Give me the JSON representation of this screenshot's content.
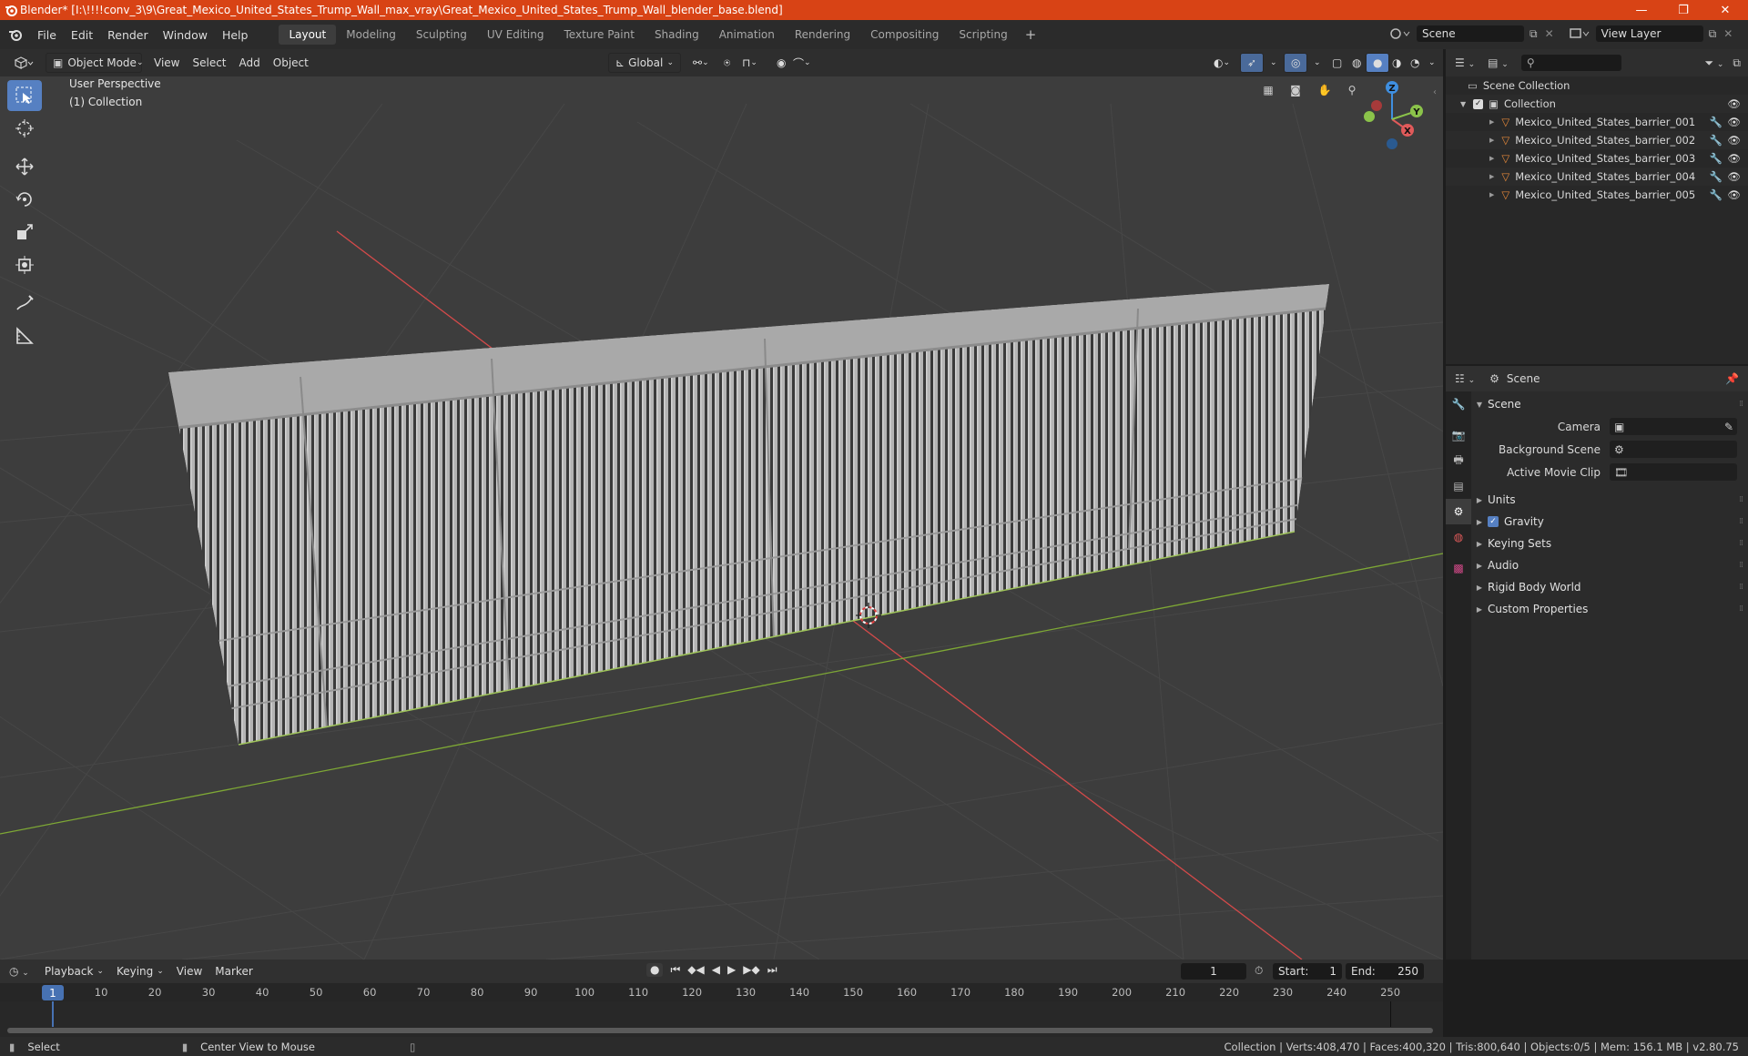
{
  "window": {
    "title": "Blender* [I:\\!!!!conv_3\\9\\Great_Mexico_United_States_Trump_Wall_max_vray\\Great_Mexico_United_States_Trump_Wall_blender_base.blend]",
    "controls": [
      "—",
      "❐",
      "✕"
    ]
  },
  "menu": [
    "File",
    "Edit",
    "Render",
    "Window",
    "Help"
  ],
  "workspaces": [
    "Layout",
    "Modeling",
    "Sculpting",
    "UV Editing",
    "Texture Paint",
    "Shading",
    "Animation",
    "Rendering",
    "Compositing",
    "Scripting"
  ],
  "active_workspace": "Layout",
  "scene_selector": "Scene",
  "view_layer": "View Layer",
  "viewport": {
    "mode": "Object Mode",
    "menus": [
      "View",
      "Select",
      "Add",
      "Object"
    ],
    "transform_orientation": "Global",
    "overlay_line1": "User Perspective",
    "overlay_line2": "(1) Collection",
    "gizmo": {
      "x": "X",
      "y": "Y",
      "z": "Z"
    }
  },
  "outliner": {
    "root": "Scene Collection",
    "collection": "Collection",
    "objects": [
      "Mexico_United_States_barrier_001",
      "Mexico_United_States_barrier_002",
      "Mexico_United_States_barrier_003",
      "Mexico_United_States_barrier_004",
      "Mexico_United_States_barrier_005"
    ]
  },
  "properties": {
    "context": "Scene",
    "panel": "Scene",
    "fields": [
      {
        "label": "Camera",
        "value": ""
      },
      {
        "label": "Background Scene",
        "value": ""
      },
      {
        "label": "Active Movie Clip",
        "value": ""
      }
    ],
    "sections": [
      "Units",
      "Gravity",
      "Keying Sets",
      "Audio",
      "Rigid Body World",
      "Custom Properties"
    ],
    "gravity_enabled": true
  },
  "timeline": {
    "menus": [
      "Playback",
      "Keying",
      "View",
      "Marker"
    ],
    "current_frame": "1",
    "start_label": "Start:",
    "start": "1",
    "end_label": "End:",
    "end": "250",
    "ruler": [
      "10",
      "20",
      "30",
      "40",
      "50",
      "60",
      "70",
      "80",
      "90",
      "100",
      "110",
      "120",
      "130",
      "140",
      "150",
      "160",
      "170",
      "180",
      "190",
      "200",
      "210",
      "220",
      "230",
      "240",
      "250"
    ],
    "playhead": "1"
  },
  "status": {
    "left": "Select",
    "middle": "Center View to Mouse",
    "right": "Collection | Verts:408,470 | Faces:400,320 | Tris:800,640 | Objects:0/5 | Mem: 156.1 MB | v2.80.75"
  },
  "colors": {
    "title_bar": "#d84315",
    "accent": "#5680c2",
    "x_axis": "#e05a5a",
    "y_axis": "#8bc34a",
    "z_axis": "#3f8fe0"
  }
}
